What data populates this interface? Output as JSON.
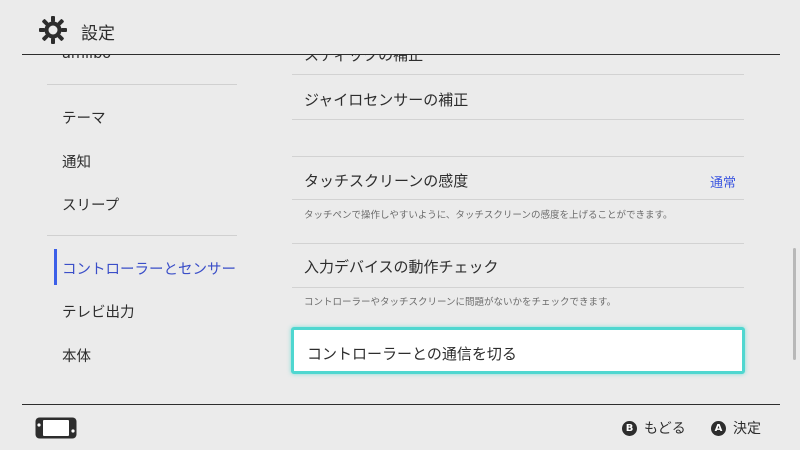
{
  "header": {
    "title": "設定",
    "icon": "gear-icon"
  },
  "sidebar": {
    "items": [
      {
        "label": "amiibo"
      },
      {
        "label": "テーマ"
      },
      {
        "label": "通知"
      },
      {
        "label": "スリープ"
      },
      {
        "label": "コントローラーとセンサー",
        "selected": true
      },
      {
        "label": "テレビ出力"
      },
      {
        "label": "本体"
      }
    ]
  },
  "content": {
    "rows": [
      {
        "title": "スティックの補正"
      },
      {
        "title": "ジャイロセンサーの補正"
      },
      {
        "title": "タッチスクリーンの感度",
        "value": "通常",
        "description": "タッチペンで操作しやすいように、タッチスクリーンの感度を上げることができます。"
      },
      {
        "title": "入力デバイスの動作チェック",
        "description": "コントローラーやタッチスクリーンに問題がないかをチェックできます。"
      },
      {
        "title": "コントローラーとの通信を切る",
        "focused": true
      }
    ]
  },
  "footer": {
    "icon": "switch-console-icon",
    "hints": [
      {
        "button": "B",
        "label": "もどる"
      },
      {
        "button": "A",
        "label": "決定"
      }
    ]
  },
  "colors": {
    "background": "#ebebeb",
    "accent_blue": "#3c5fe8",
    "focus_cyan": "#4fd7d0",
    "text": "#2d2d2d"
  }
}
